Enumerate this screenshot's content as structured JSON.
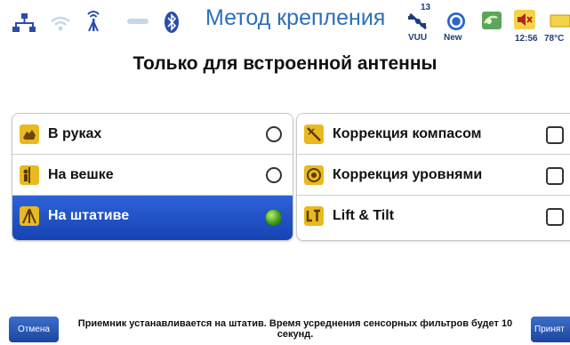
{
  "header": {
    "title": "Метод крепления",
    "satellite_count": "13",
    "satellite_label": "VUU",
    "new_label": "New",
    "time": "12:56",
    "temperature": "78°C",
    "icons": [
      "network-icon",
      "wifi-icon",
      "radio-antenna-icon",
      "link-icon",
      "bluetooth-icon",
      "satellite-icon",
      "new-badge-icon",
      "map-icon",
      "volume-mute-icon",
      "battery-icon"
    ]
  },
  "subtitle": "Только для встроенной антенны",
  "mount_options": [
    {
      "label": "В руках",
      "icon": "hands-icon",
      "selected": false
    },
    {
      "label": "На вешке",
      "icon": "pole-icon",
      "selected": false
    },
    {
      "label": "На штативе",
      "icon": "tripod-icon",
      "selected": true
    }
  ],
  "corrections": [
    {
      "label": "Коррекция компасом",
      "icon": "compass-icon",
      "checked": false
    },
    {
      "label": "Коррекция уровнями",
      "icon": "level-icon",
      "checked": false
    },
    {
      "label": "Lift & Tilt",
      "icon": "lift-tilt-icon",
      "checked": false
    }
  ],
  "footer": {
    "cancel_label": "Отмена",
    "accept_label": "Принят",
    "hint": "Приемник устанавливается на штатив. Время усреднения сенсорных фильтров будет 10 секунд."
  },
  "colors": {
    "accent": "#1f4fc4",
    "title": "#2d6fb8",
    "selected_radio": "#3d9a19"
  }
}
